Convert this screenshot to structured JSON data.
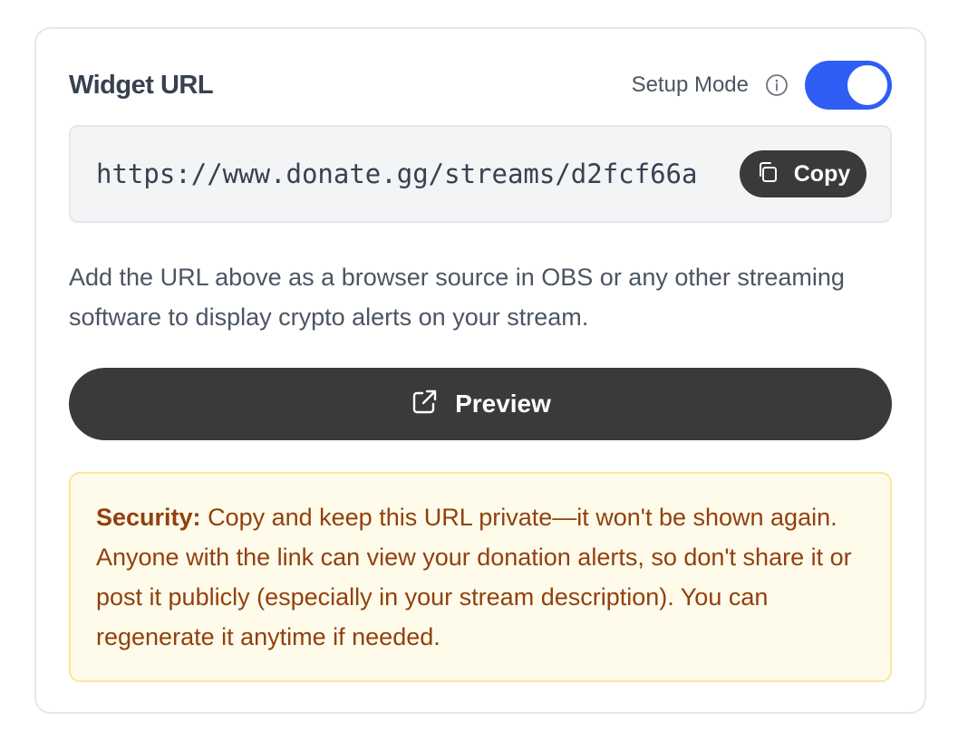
{
  "widget": {
    "title": "Widget URL",
    "setup_mode_label": "Setup Mode",
    "setup_mode_on": true,
    "info_icon": "info-icon",
    "accent_color": "#2f5ef5"
  },
  "url_box": {
    "url": "https://www.donate.gg/streams/d2fcf66a",
    "copy_label": "Copy",
    "copy_icon": "copy-icon"
  },
  "description": "Add the URL above as a browser source in OBS or any other streaming software to display crypto alerts on your stream.",
  "preview": {
    "label": "Preview",
    "icon": "external-link-icon"
  },
  "security": {
    "label": "Security:",
    "text": "Copy and keep this URL private—it won't be shown again. Anyone with the link can view your donation alerts, so don't share it or post it publicly (especially in your stream description). You can regenerate it anytime if needed."
  }
}
